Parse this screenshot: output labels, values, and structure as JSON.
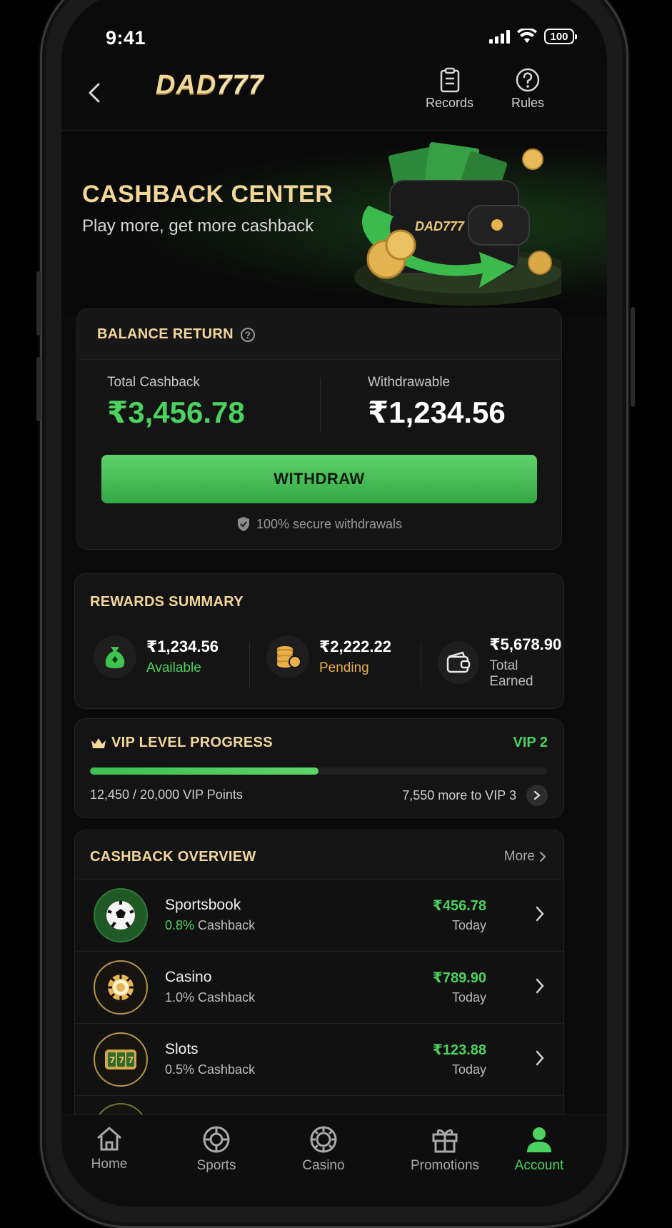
{
  "status_bar": {
    "time": "9:41",
    "battery": "100"
  },
  "header": {
    "logo_text": "DAD",
    "logo_digits": "777",
    "records_label": "Records",
    "rules_label": "Rules"
  },
  "hero": {
    "title": "CASHBACK CENTER",
    "subtitle": "Play more, get more cashback",
    "wallet_brand": "DAD777"
  },
  "balance": {
    "title": "BALANCE RETURN",
    "total_label": "Total Cashback",
    "total_value": "₹3,456.78",
    "withdrawable_label": "Withdrawable",
    "withdrawable_value": "₹1,234.56",
    "withdraw_button": "WITHDRAW",
    "secure_note": "100% secure withdrawals"
  },
  "rewards": {
    "title": "REWARDS SUMMARY",
    "items": [
      {
        "amount": "₹1,234.56",
        "label": "Available",
        "icon": "money-bag-icon"
      },
      {
        "amount": "₹2,222.22",
        "label": "Pending",
        "icon": "coin-stack-icon"
      },
      {
        "amount": "₹5,678.90",
        "label": "Total Earned",
        "icon": "wallet-icon"
      }
    ]
  },
  "vip": {
    "title": "VIP LEVEL PROGRESS",
    "level": "VIP 2",
    "points_text": "12,450 / 20,000 VIP Points",
    "more_text": "7,550 more to VIP 3",
    "progress_fraction": 0.5
  },
  "overview": {
    "title": "CASHBACK OVERVIEW",
    "more_label": "More",
    "rows": [
      {
        "name": "Sportsbook",
        "rate": "0.8%",
        "rate_suffix": " Cashback",
        "amount": "₹456.78",
        "when": "Today",
        "icon": "soccer-ball-icon"
      },
      {
        "name": "Casino",
        "rate": "1.0% Cashback",
        "amount": "₹789.90",
        "when": "Today",
        "icon": "casino-chip-icon"
      },
      {
        "name": "Slots",
        "rate": "0.5% Cashback",
        "amount": "₹123.88",
        "when": "Today",
        "icon": "slot-machine-icon"
      }
    ]
  },
  "tabbar": {
    "tabs": [
      {
        "label": "Home",
        "icon": "home-icon"
      },
      {
        "label": "Sports",
        "icon": "sports-ball-icon"
      },
      {
        "label": "Casino",
        "icon": "casino-chip-icon"
      },
      {
        "label": "Promotions",
        "icon": "gift-icon"
      },
      {
        "label": "Account",
        "icon": "user-icon"
      }
    ],
    "active": "Account"
  },
  "colors": {
    "accent_green": "#4cd25f",
    "gold": "#f2d79b",
    "pending_gold": "#e9b14c",
    "background": "#0b0b0b"
  }
}
